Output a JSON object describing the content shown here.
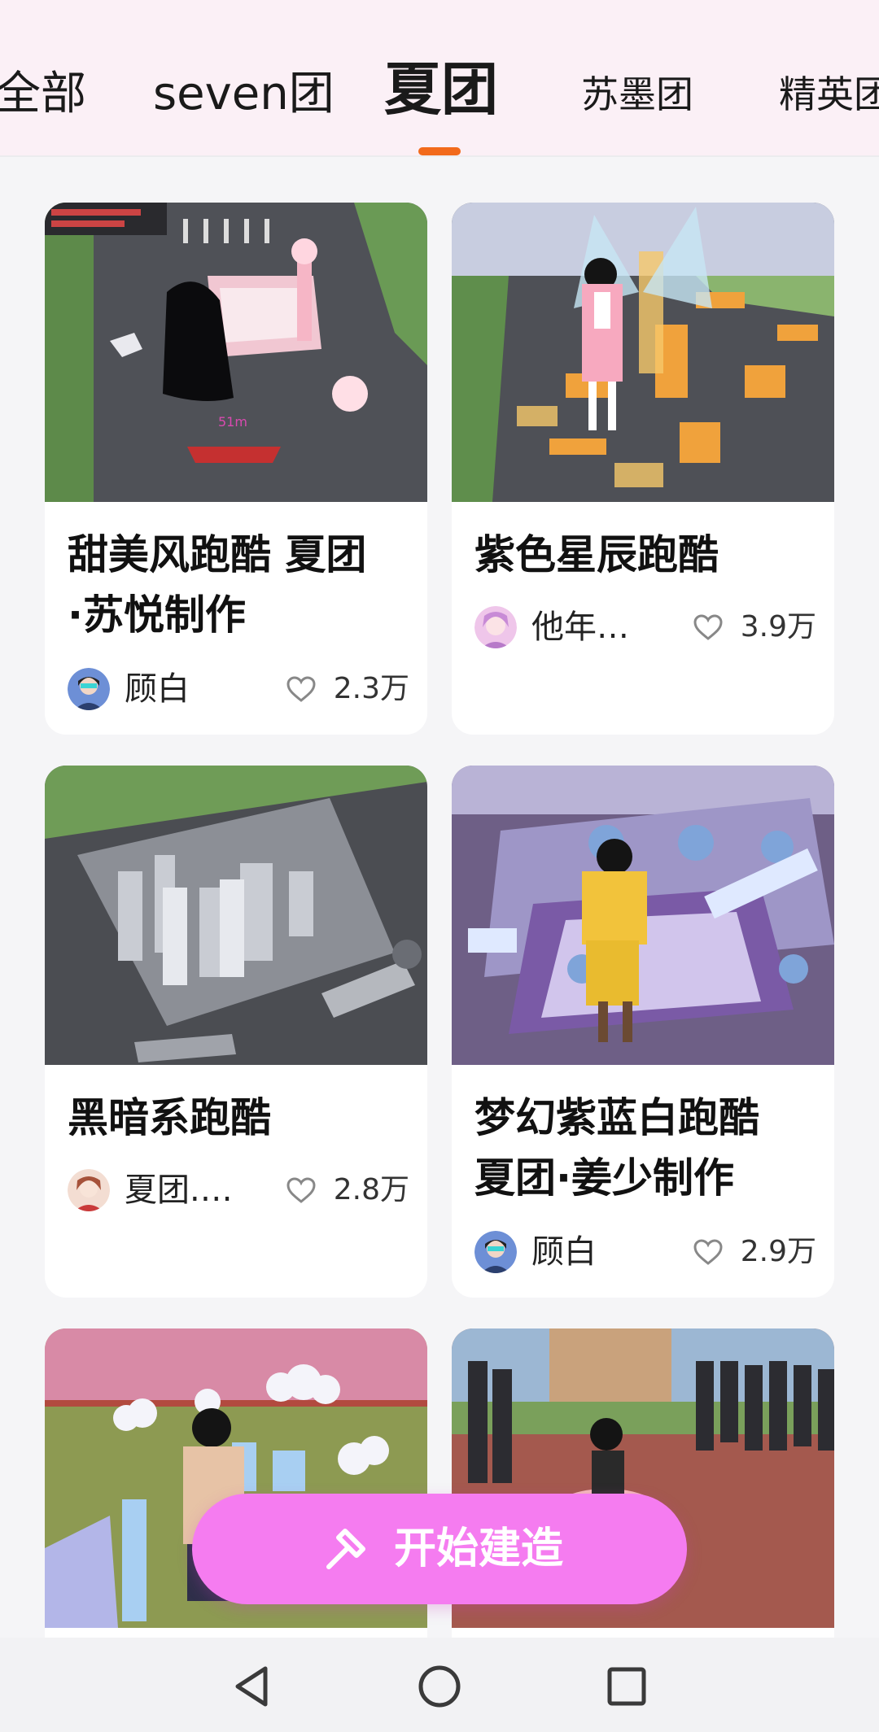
{
  "tabs": [
    {
      "label": "全部",
      "active": false
    },
    {
      "label": "seven团",
      "active": false
    },
    {
      "label": "夏团",
      "active": true
    },
    {
      "label": "苏墨团",
      "active": false
    },
    {
      "label": "精英团",
      "active": false
    }
  ],
  "accent_color": "#f26a1b",
  "cards": [
    {
      "title_line1": "甜美风跑酷 夏团",
      "title_line2": "·苏悦制作",
      "author": "顾白",
      "likes": "2.3万",
      "avatar_icon": "avatar-icon",
      "thumb_overlay_text": "51m"
    },
    {
      "title_line1": "紫色星辰跑酷",
      "title_line2": "",
      "author": "他年…",
      "likes": "3.9万",
      "avatar_icon": "avatar-icon"
    },
    {
      "title_line1": "黑暗系跑酷",
      "title_line2": "",
      "author": "夏团.…",
      "likes": "2.8万",
      "avatar_icon": "avatar-icon"
    },
    {
      "title_line1": "梦幻紫蓝白跑酷",
      "title_line2": "夏团·姜少制作",
      "author": "顾白",
      "likes": "2.9万",
      "avatar_icon": "avatar-icon"
    },
    {
      "title_line1": "",
      "title_line2": "",
      "author": "",
      "likes": ""
    },
    {
      "title_line1": "",
      "title_line2": "",
      "author": "",
      "likes": ""
    }
  ],
  "fab": {
    "label": "开始建造",
    "icon": "hammer-icon",
    "color": "#f57cf0"
  },
  "navbar": {
    "back_icon": "back-triangle-icon",
    "home_icon": "home-circle-icon",
    "recent_icon": "recent-square-icon"
  }
}
